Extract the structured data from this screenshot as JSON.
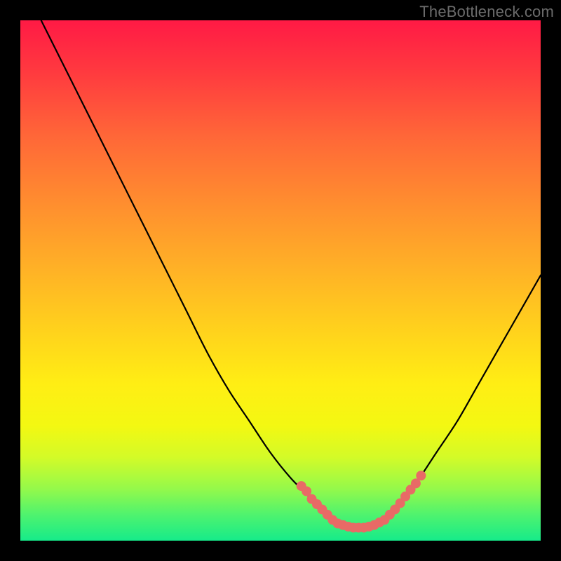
{
  "watermark": "TheBottleneck.com",
  "colors": {
    "background": "#000000",
    "curve": "#000000",
    "marker": "#e86a66",
    "gradient_top": "#ff1a45",
    "gradient_bottom": "#16eb8a"
  },
  "chart_data": {
    "type": "line",
    "title": "",
    "xlabel": "",
    "ylabel": "",
    "xlim": [
      0,
      100
    ],
    "ylim": [
      0,
      100
    ],
    "annotations": [],
    "series": [
      {
        "name": "bottleneck-curve",
        "x": [
          4,
          8,
          12,
          16,
          20,
          24,
          28,
          32,
          36,
          40,
          44,
          48,
          52,
          56,
          58,
          60,
          62,
          64,
          66,
          68,
          70,
          72,
          76,
          80,
          84,
          88,
          92,
          96,
          100
        ],
        "y": [
          100,
          92,
          84,
          76,
          68,
          60,
          52,
          44,
          36,
          29,
          23,
          17,
          12,
          8,
          6,
          4,
          3,
          2.5,
          2.5,
          3,
          4,
          6,
          11,
          17,
          23,
          30,
          37,
          44,
          51
        ]
      }
    ],
    "markers": {
      "name": "overlay-dots",
      "points": [
        {
          "x": 54,
          "y": 10.5
        },
        {
          "x": 55,
          "y": 9.5
        },
        {
          "x": 56,
          "y": 8.0
        },
        {
          "x": 57,
          "y": 7.0
        },
        {
          "x": 58,
          "y": 6.0
        },
        {
          "x": 59,
          "y": 5.0
        },
        {
          "x": 60,
          "y": 4.0
        },
        {
          "x": 61,
          "y": 3.3
        },
        {
          "x": 62,
          "y": 3.0
        },
        {
          "x": 63,
          "y": 2.7
        },
        {
          "x": 64,
          "y": 2.5
        },
        {
          "x": 65,
          "y": 2.5
        },
        {
          "x": 66,
          "y": 2.5
        },
        {
          "x": 67,
          "y": 2.7
        },
        {
          "x": 68,
          "y": 3.0
        },
        {
          "x": 69,
          "y": 3.5
        },
        {
          "x": 70,
          "y": 4.0
        },
        {
          "x": 71,
          "y": 5.0
        },
        {
          "x": 72,
          "y": 6.0
        },
        {
          "x": 73,
          "y": 7.2
        },
        {
          "x": 74,
          "y": 8.5
        },
        {
          "x": 75,
          "y": 9.8
        },
        {
          "x": 76,
          "y": 11.0
        },
        {
          "x": 77,
          "y": 12.5
        }
      ]
    }
  }
}
